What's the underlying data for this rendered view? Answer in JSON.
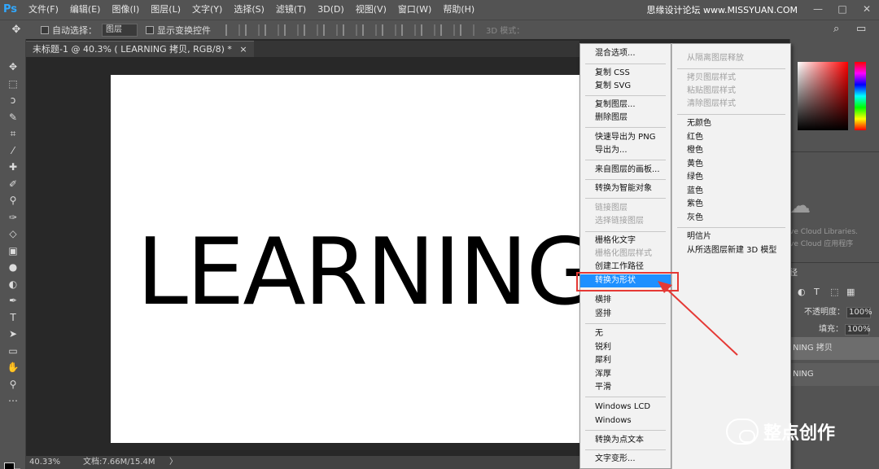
{
  "app": {
    "logo": "Ps",
    "menu": [
      "文件(F)",
      "编辑(E)",
      "图像(I)",
      "图层(L)",
      "文字(Y)",
      "选择(S)",
      "滤镜(T)",
      "3D(D)",
      "视图(V)",
      "窗口(W)",
      "帮助(H)"
    ],
    "watermark_top": "思缘设计论坛 www.MISSYUAN.COM",
    "window_controls": [
      "—",
      "□",
      "✕"
    ]
  },
  "options": {
    "auto_select_label": "自动选择：",
    "auto_select_value": "图层",
    "show_transform_label": "显示变换控件",
    "mode_3d_label": "3D 模式："
  },
  "document": {
    "tab_title": "未标题-1 @ 40.3% ( LEARNING 拷贝, RGB/8) *",
    "tab_close": "×",
    "canvas_text": "LEARNING",
    "zoom": "40.33%",
    "doc_info": "文档:7.66M/15.4M",
    "status_arrow": "〉"
  },
  "context_menu": {
    "main_items": [
      {
        "label": "混合选项...",
        "disabled": false
      },
      {
        "label": "复制 CSS",
        "disabled": false
      },
      {
        "label": "复制 SVG",
        "disabled": false
      },
      {
        "label": "复制图层...",
        "disabled": false
      },
      {
        "label": "删除图层",
        "disabled": false
      },
      {
        "label": "快速导出为 PNG",
        "disabled": false
      },
      {
        "label": "导出为...",
        "disabled": false
      },
      {
        "label": "来自图层的画板...",
        "disabled": false
      },
      {
        "label": "转换为智能对象",
        "disabled": false
      },
      {
        "label": "链接图层",
        "disabled": true
      },
      {
        "label": "选择链接图层",
        "disabled": true
      },
      {
        "label": "栅格化文字",
        "disabled": false
      },
      {
        "label": "栅格化图层样式",
        "disabled": true
      },
      {
        "label": "创建工作路径",
        "disabled": false
      },
      {
        "label": "转换为形状",
        "disabled": false,
        "selected": true
      },
      {
        "label": "横排",
        "disabled": false
      },
      {
        "label": "竖排",
        "disabled": false
      },
      {
        "label": "无",
        "disabled": false
      },
      {
        "label": "锐利",
        "disabled": false
      },
      {
        "label": "犀利",
        "disabled": false
      },
      {
        "label": "浑厚",
        "disabled": false
      },
      {
        "label": "平滑",
        "disabled": false
      },
      {
        "label": "Windows LCD",
        "disabled": false
      },
      {
        "label": "Windows",
        "disabled": false
      },
      {
        "label": "转换为点文本",
        "disabled": false
      },
      {
        "label": "文字变形...",
        "disabled": false
      }
    ],
    "sub_items": [
      {
        "label": "从隔离图层释放",
        "disabled": true
      },
      {
        "label": "拷贝图层样式",
        "disabled": true
      },
      {
        "label": "粘贴图层样式",
        "disabled": true
      },
      {
        "label": "清除图层样式",
        "disabled": true
      },
      {
        "label": "无颜色",
        "disabled": false
      },
      {
        "label": "红色",
        "disabled": false
      },
      {
        "label": "橙色",
        "disabled": false
      },
      {
        "label": "黄色",
        "disabled": false
      },
      {
        "label": "绿色",
        "disabled": false
      },
      {
        "label": "蓝色",
        "disabled": false
      },
      {
        "label": "紫色",
        "disabled": false
      },
      {
        "label": "灰色",
        "disabled": false
      },
      {
        "label": "明信片",
        "disabled": false
      },
      {
        "label": "从所选图层新建 3D 模型",
        "disabled": false
      }
    ]
  },
  "right_panel": {
    "cloud_line1": "ve Cloud Libraries.",
    "cloud_line2": "ve Cloud 应用程序",
    "opacity_label": "不透明度：",
    "opacity_value": "100%",
    "fill_label": "填充：",
    "fill_value": "100%",
    "layer_1": "NING 拷贝",
    "layer_2": "NING",
    "tab_label": "径"
  },
  "branding": {
    "wechat_label": "整点创作"
  },
  "colors": {
    "selected_menu": "#1e90ff",
    "annotation_red": "#e53935"
  }
}
